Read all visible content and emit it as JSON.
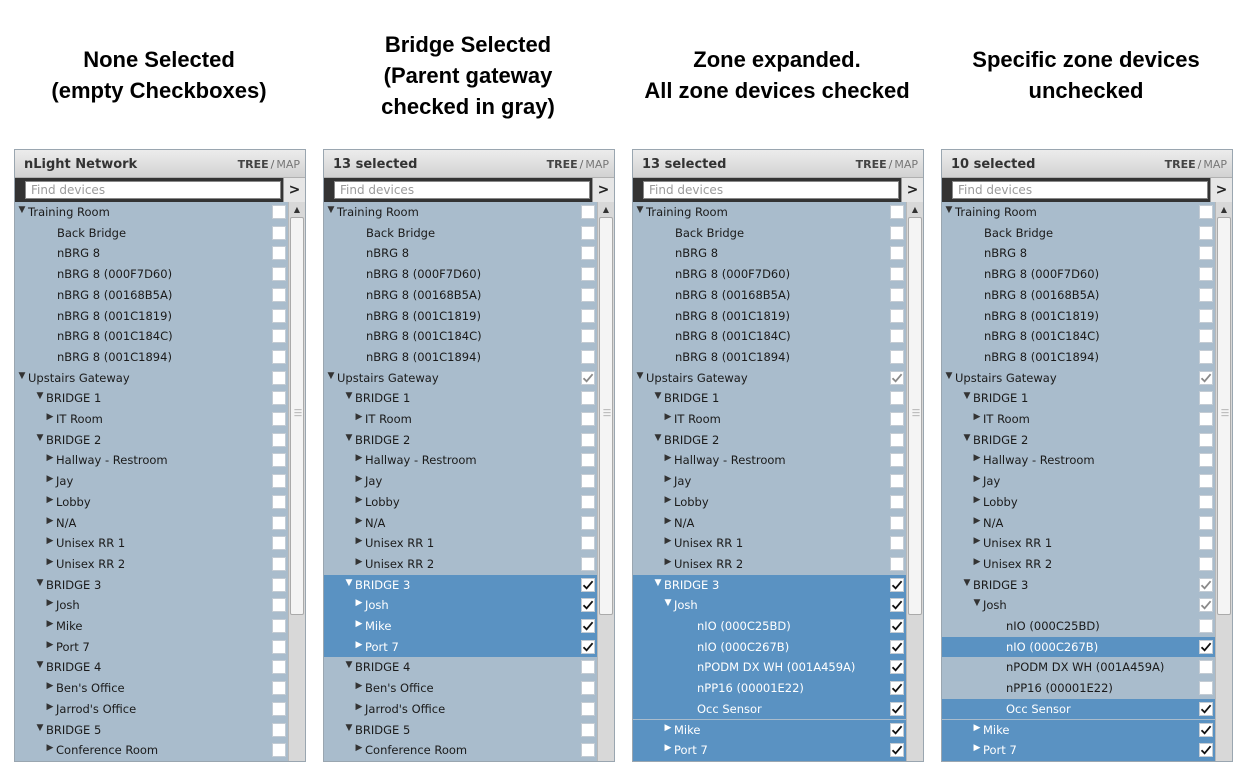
{
  "captions": [
    [
      "None Selected",
      "(empty Checkboxes)"
    ],
    [
      "Bridge Selected",
      "(Parent gateway",
      "checked in gray)"
    ],
    [
      "Zone expanded.",
      "All zone devices checked"
    ],
    [
      "Specific zone devices",
      "unchecked"
    ]
  ],
  "view_toggle": {
    "tree": "TREE",
    "separator": "/",
    "map": "MAP"
  },
  "search": {
    "placeholder": "Find devices",
    "button": ">"
  },
  "icons": {
    "expanded": "triangle-down",
    "collapsed": "triangle-right",
    "scroll_up": "triangle-up",
    "grip": "scroll-grip-lines"
  },
  "colors": {
    "selected_row": "#5a92c2",
    "row_bg": "#a9bccc",
    "partial_check": "#8a8a8a"
  },
  "panels": [
    {
      "title": "nLight Network",
      "rows": [
        {
          "label": "Training Room",
          "indent": 0,
          "arrow": "down",
          "check": "off",
          "sel": false
        },
        {
          "label": "Back Bridge",
          "indent": 2,
          "arrow": "",
          "check": "off",
          "sel": false
        },
        {
          "label": "nBRG 8",
          "indent": 2,
          "arrow": "",
          "check": "off",
          "sel": false
        },
        {
          "label": "nBRG 8 (000F7D60)",
          "indent": 2,
          "arrow": "",
          "check": "off",
          "sel": false
        },
        {
          "label": "nBRG 8 (00168B5A)",
          "indent": 2,
          "arrow": "",
          "check": "off",
          "sel": false
        },
        {
          "label": "nBRG 8 (001C1819)",
          "indent": 2,
          "arrow": "",
          "check": "off",
          "sel": false
        },
        {
          "label": "nBRG 8 (001C184C)",
          "indent": 2,
          "arrow": "",
          "check": "off",
          "sel": false
        },
        {
          "label": "nBRG 8 (001C1894)",
          "indent": 2,
          "arrow": "",
          "check": "off",
          "sel": false
        },
        {
          "label": "Upstairs Gateway",
          "indent": 0,
          "arrow": "down",
          "check": "off",
          "sel": false
        },
        {
          "label": "BRIDGE 1",
          "indent": 1,
          "arrow": "down",
          "check": "off",
          "sel": false
        },
        {
          "label": "IT Room",
          "indent": 2,
          "arrow": "right",
          "check": "off",
          "sel": false
        },
        {
          "label": "BRIDGE 2",
          "indent": 1,
          "arrow": "down",
          "check": "off",
          "sel": false
        },
        {
          "label": "Hallway - Restroom",
          "indent": 2,
          "arrow": "right",
          "check": "off",
          "sel": false
        },
        {
          "label": "Jay",
          "indent": 2,
          "arrow": "right",
          "check": "off",
          "sel": false
        },
        {
          "label": "Lobby",
          "indent": 2,
          "arrow": "right",
          "check": "off",
          "sel": false
        },
        {
          "label": "N/A",
          "indent": 2,
          "arrow": "right",
          "check": "off",
          "sel": false
        },
        {
          "label": "Unisex RR 1",
          "indent": 2,
          "arrow": "right",
          "check": "off",
          "sel": false
        },
        {
          "label": "Unisex RR 2",
          "indent": 2,
          "arrow": "right",
          "check": "off",
          "sel": false
        },
        {
          "label": "BRIDGE 3",
          "indent": 1,
          "arrow": "down",
          "check": "off",
          "sel": false
        },
        {
          "label": "Josh",
          "indent": 2,
          "arrow": "right",
          "check": "off",
          "sel": false
        },
        {
          "label": "Mike",
          "indent": 2,
          "arrow": "right",
          "check": "off",
          "sel": false
        },
        {
          "label": "Port 7",
          "indent": 2,
          "arrow": "right",
          "check": "off",
          "sel": false
        },
        {
          "label": "BRIDGE 4",
          "indent": 1,
          "arrow": "down",
          "check": "off",
          "sel": false
        },
        {
          "label": "Ben's Office",
          "indent": 2,
          "arrow": "right",
          "check": "off",
          "sel": false
        },
        {
          "label": "Jarrod's Office",
          "indent": 2,
          "arrow": "right",
          "check": "off",
          "sel": false
        },
        {
          "label": "BRIDGE 5",
          "indent": 1,
          "arrow": "down",
          "check": "off",
          "sel": false
        },
        {
          "label": "Conference Room",
          "indent": 2,
          "arrow": "right",
          "check": "off",
          "sel": false
        }
      ]
    },
    {
      "title": "13 selected",
      "rows": [
        {
          "label": "Training Room",
          "indent": 0,
          "arrow": "down",
          "check": "off",
          "sel": false
        },
        {
          "label": "Back Bridge",
          "indent": 2,
          "arrow": "",
          "check": "off",
          "sel": false
        },
        {
          "label": "nBRG 8",
          "indent": 2,
          "arrow": "",
          "check": "off",
          "sel": false
        },
        {
          "label": "nBRG 8 (000F7D60)",
          "indent": 2,
          "arrow": "",
          "check": "off",
          "sel": false
        },
        {
          "label": "nBRG 8 (00168B5A)",
          "indent": 2,
          "arrow": "",
          "check": "off",
          "sel": false
        },
        {
          "label": "nBRG 8 (001C1819)",
          "indent": 2,
          "arrow": "",
          "check": "off",
          "sel": false
        },
        {
          "label": "nBRG 8 (001C184C)",
          "indent": 2,
          "arrow": "",
          "check": "off",
          "sel": false
        },
        {
          "label": "nBRG 8 (001C1894)",
          "indent": 2,
          "arrow": "",
          "check": "off",
          "sel": false
        },
        {
          "label": "Upstairs Gateway",
          "indent": 0,
          "arrow": "down",
          "check": "partial",
          "sel": false
        },
        {
          "label": "BRIDGE 1",
          "indent": 1,
          "arrow": "down",
          "check": "off",
          "sel": false
        },
        {
          "label": "IT Room",
          "indent": 2,
          "arrow": "right",
          "check": "off",
          "sel": false
        },
        {
          "label": "BRIDGE 2",
          "indent": 1,
          "arrow": "down",
          "check": "off",
          "sel": false
        },
        {
          "label": "Hallway - Restroom",
          "indent": 2,
          "arrow": "right",
          "check": "off",
          "sel": false
        },
        {
          "label": "Jay",
          "indent": 2,
          "arrow": "right",
          "check": "off",
          "sel": false
        },
        {
          "label": "Lobby",
          "indent": 2,
          "arrow": "right",
          "check": "off",
          "sel": false
        },
        {
          "label": "N/A",
          "indent": 2,
          "arrow": "right",
          "check": "off",
          "sel": false
        },
        {
          "label": "Unisex RR 1",
          "indent": 2,
          "arrow": "right",
          "check": "off",
          "sel": false
        },
        {
          "label": "Unisex RR 2",
          "indent": 2,
          "arrow": "right",
          "check": "off",
          "sel": false
        },
        {
          "label": "BRIDGE 3",
          "indent": 1,
          "arrow": "down",
          "check": "on",
          "sel": true
        },
        {
          "label": "Josh",
          "indent": 2,
          "arrow": "right",
          "check": "on",
          "sel": true
        },
        {
          "label": "Mike",
          "indent": 2,
          "arrow": "right",
          "check": "on",
          "sel": true
        },
        {
          "label": "Port 7",
          "indent": 2,
          "arrow": "right",
          "check": "on",
          "sel": true
        },
        {
          "label": "BRIDGE 4",
          "indent": 1,
          "arrow": "down",
          "check": "off",
          "sel": false
        },
        {
          "label": "Ben's Office",
          "indent": 2,
          "arrow": "right",
          "check": "off",
          "sel": false
        },
        {
          "label": "Jarrod's Office",
          "indent": 2,
          "arrow": "right",
          "check": "off",
          "sel": false
        },
        {
          "label": "BRIDGE 5",
          "indent": 1,
          "arrow": "down",
          "check": "off",
          "sel": false
        },
        {
          "label": "Conference Room",
          "indent": 2,
          "arrow": "right",
          "check": "off",
          "sel": false
        }
      ]
    },
    {
      "title": "13 selected",
      "rows": [
        {
          "label": "Training Room",
          "indent": 0,
          "arrow": "down",
          "check": "off",
          "sel": false
        },
        {
          "label": "Back Bridge",
          "indent": 2,
          "arrow": "",
          "check": "off",
          "sel": false
        },
        {
          "label": "nBRG 8",
          "indent": 2,
          "arrow": "",
          "check": "off",
          "sel": false
        },
        {
          "label": "nBRG 8 (000F7D60)",
          "indent": 2,
          "arrow": "",
          "check": "off",
          "sel": false
        },
        {
          "label": "nBRG 8 (00168B5A)",
          "indent": 2,
          "arrow": "",
          "check": "off",
          "sel": false
        },
        {
          "label": "nBRG 8 (001C1819)",
          "indent": 2,
          "arrow": "",
          "check": "off",
          "sel": false
        },
        {
          "label": "nBRG 8 (001C184C)",
          "indent": 2,
          "arrow": "",
          "check": "off",
          "sel": false
        },
        {
          "label": "nBRG 8 (001C1894)",
          "indent": 2,
          "arrow": "",
          "check": "off",
          "sel": false
        },
        {
          "label": "Upstairs Gateway",
          "indent": 0,
          "arrow": "down",
          "check": "partial",
          "sel": false
        },
        {
          "label": "BRIDGE 1",
          "indent": 1,
          "arrow": "down",
          "check": "off",
          "sel": false
        },
        {
          "label": "IT Room",
          "indent": 2,
          "arrow": "right",
          "check": "off",
          "sel": false
        },
        {
          "label": "BRIDGE 2",
          "indent": 1,
          "arrow": "down",
          "check": "off",
          "sel": false
        },
        {
          "label": "Hallway - Restroom",
          "indent": 2,
          "arrow": "right",
          "check": "off",
          "sel": false
        },
        {
          "label": "Jay",
          "indent": 2,
          "arrow": "right",
          "check": "off",
          "sel": false
        },
        {
          "label": "Lobby",
          "indent": 2,
          "arrow": "right",
          "check": "off",
          "sel": false
        },
        {
          "label": "N/A",
          "indent": 2,
          "arrow": "right",
          "check": "off",
          "sel": false
        },
        {
          "label": "Unisex RR 1",
          "indent": 2,
          "arrow": "right",
          "check": "off",
          "sel": false
        },
        {
          "label": "Unisex RR 2",
          "indent": 2,
          "arrow": "right",
          "check": "off",
          "sel": false
        },
        {
          "label": "BRIDGE 3",
          "indent": 1,
          "arrow": "down",
          "check": "on",
          "sel": true
        },
        {
          "label": "Josh",
          "indent": 2,
          "arrow": "down",
          "check": "on",
          "sel": true
        },
        {
          "label": "nIO (000C25BD)",
          "indent": 3,
          "arrow": "",
          "check": "on",
          "sel": true
        },
        {
          "label": "nIO (000C267B)",
          "indent": 3,
          "arrow": "",
          "check": "on",
          "sel": true
        },
        {
          "label": "nPODM DX WH (001A459A)",
          "indent": 3,
          "arrow": "",
          "check": "on",
          "sel": true
        },
        {
          "label": "nPP16 (00001E22)",
          "indent": 3,
          "arrow": "",
          "check": "on",
          "sel": true
        },
        {
          "label": "Occ Sensor",
          "indent": 3,
          "arrow": "",
          "check": "on",
          "sel": true
        },
        {
          "label": "Mike",
          "indent": 2,
          "arrow": "right",
          "check": "on",
          "sel": true
        },
        {
          "label": "Port 7",
          "indent": 2,
          "arrow": "right",
          "check": "on",
          "sel": true
        }
      ]
    },
    {
      "title": "10 selected",
      "rows": [
        {
          "label": "Training Room",
          "indent": 0,
          "arrow": "down",
          "check": "off",
          "sel": false
        },
        {
          "label": "Back Bridge",
          "indent": 2,
          "arrow": "",
          "check": "off",
          "sel": false
        },
        {
          "label": "nBRG 8",
          "indent": 2,
          "arrow": "",
          "check": "off",
          "sel": false
        },
        {
          "label": "nBRG 8 (000F7D60)",
          "indent": 2,
          "arrow": "",
          "check": "off",
          "sel": false
        },
        {
          "label": "nBRG 8 (00168B5A)",
          "indent": 2,
          "arrow": "",
          "check": "off",
          "sel": false
        },
        {
          "label": "nBRG 8 (001C1819)",
          "indent": 2,
          "arrow": "",
          "check": "off",
          "sel": false
        },
        {
          "label": "nBRG 8 (001C184C)",
          "indent": 2,
          "arrow": "",
          "check": "off",
          "sel": false
        },
        {
          "label": "nBRG 8 (001C1894)",
          "indent": 2,
          "arrow": "",
          "check": "off",
          "sel": false
        },
        {
          "label": "Upstairs Gateway",
          "indent": 0,
          "arrow": "down",
          "check": "partial",
          "sel": false
        },
        {
          "label": "BRIDGE 1",
          "indent": 1,
          "arrow": "down",
          "check": "off",
          "sel": false
        },
        {
          "label": "IT Room",
          "indent": 2,
          "arrow": "right",
          "check": "off",
          "sel": false
        },
        {
          "label": "BRIDGE 2",
          "indent": 1,
          "arrow": "down",
          "check": "off",
          "sel": false
        },
        {
          "label": "Hallway - Restroom",
          "indent": 2,
          "arrow": "right",
          "check": "off",
          "sel": false
        },
        {
          "label": "Jay",
          "indent": 2,
          "arrow": "right",
          "check": "off",
          "sel": false
        },
        {
          "label": "Lobby",
          "indent": 2,
          "arrow": "right",
          "check": "off",
          "sel": false
        },
        {
          "label": "N/A",
          "indent": 2,
          "arrow": "right",
          "check": "off",
          "sel": false
        },
        {
          "label": "Unisex RR 1",
          "indent": 2,
          "arrow": "right",
          "check": "off",
          "sel": false
        },
        {
          "label": "Unisex RR 2",
          "indent": 2,
          "arrow": "right",
          "check": "off",
          "sel": false
        },
        {
          "label": "BRIDGE 3",
          "indent": 1,
          "arrow": "down",
          "check": "partial",
          "sel": false
        },
        {
          "label": "Josh",
          "indent": 2,
          "arrow": "down",
          "check": "partial",
          "sel": false
        },
        {
          "label": "nIO (000C25BD)",
          "indent": 3,
          "arrow": "",
          "check": "off",
          "sel": false
        },
        {
          "label": "nIO (000C267B)",
          "indent": 3,
          "arrow": "",
          "check": "on",
          "sel": true
        },
        {
          "label": "nPODM DX WH (001A459A)",
          "indent": 3,
          "arrow": "",
          "check": "off",
          "sel": false
        },
        {
          "label": "nPP16 (00001E22)",
          "indent": 3,
          "arrow": "",
          "check": "off",
          "sel": false
        },
        {
          "label": "Occ Sensor",
          "indent": 3,
          "arrow": "",
          "check": "on",
          "sel": true
        },
        {
          "label": "Mike",
          "indent": 2,
          "arrow": "right",
          "check": "on",
          "sel": true
        },
        {
          "label": "Port 7",
          "indent": 2,
          "arrow": "right",
          "check": "on",
          "sel": true
        }
      ]
    }
  ]
}
